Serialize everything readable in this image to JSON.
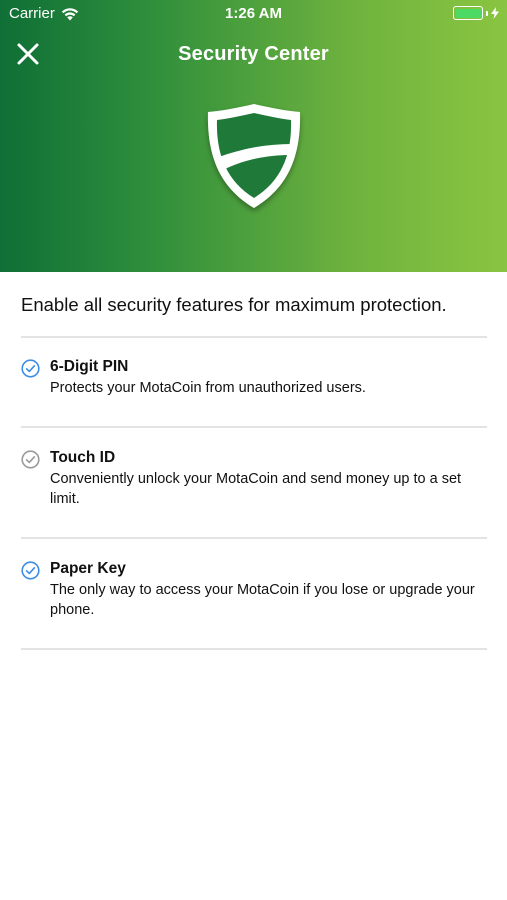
{
  "status_bar": {
    "carrier": "Carrier",
    "time": "1:26 AM",
    "battery_color": "#4cd964"
  },
  "header": {
    "title": "Security Center",
    "close_icon": "close-icon",
    "shield_icon": "shield-icon",
    "gradient_colors": [
      "#0f6f36",
      "#8ac541"
    ]
  },
  "intro": "Enable all security features for maximum protection.",
  "features": [
    {
      "title": "6-Digit PIN",
      "description": "Protects your MotaCoin from unauthorized users.",
      "enabled": true,
      "icon": "check-circle-icon",
      "color": "#3d8de3"
    },
    {
      "title": "Touch ID",
      "description": "Conveniently unlock your MotaCoin and send money up to a set limit.",
      "enabled": false,
      "icon": "check-circle-icon",
      "color": "#9a9a9a"
    },
    {
      "title": "Paper Key",
      "description": "The only way to access your MotaCoin if you lose or upgrade your phone.",
      "enabled": true,
      "icon": "check-circle-icon",
      "color": "#3d8de3"
    }
  ]
}
